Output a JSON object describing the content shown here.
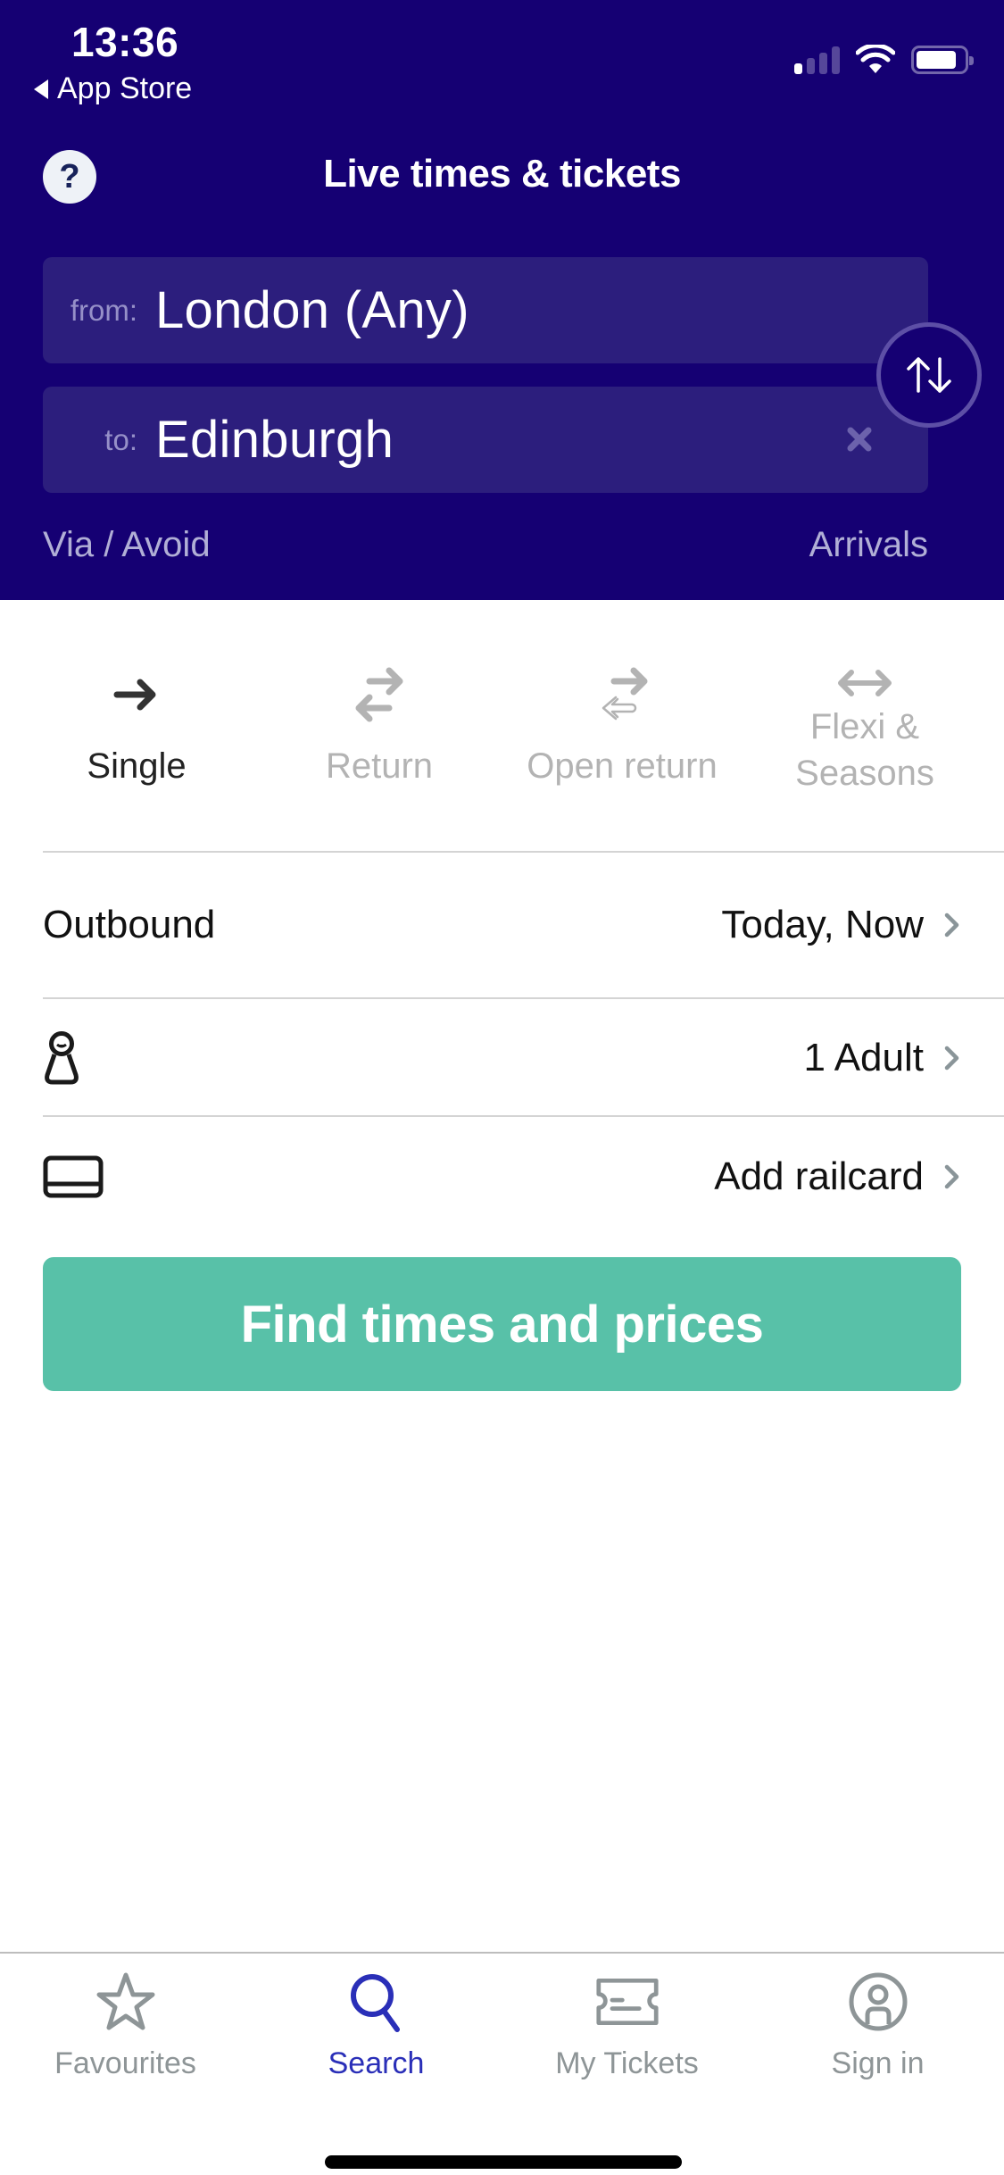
{
  "status_bar": {
    "time": "13:36",
    "back_label": "App Store",
    "signal_bars_on": 1,
    "signal_bars_total": 4,
    "battery_level": 0.85
  },
  "header": {
    "title": "Live times & tickets",
    "help_icon": "?",
    "from_label": "from:",
    "from_value": "London (Any)",
    "to_label": "to:",
    "to_value": "Edinburgh",
    "via_avoid": "Via / Avoid",
    "arrivals": "Arrivals"
  },
  "journey_types": [
    {
      "label": "Single",
      "icon": "arrow-right-icon",
      "active": true
    },
    {
      "label": "Return",
      "icon": "return-arrows-icon",
      "active": false
    },
    {
      "label": "Open return",
      "icon": "open-return-arrows-icon",
      "active": false
    },
    {
      "label": "Flexi & Seasons",
      "label_line1": "Flexi &",
      "label_line2": "Seasons",
      "icon": "double-arrow-icon",
      "active": false
    }
  ],
  "rows": {
    "outbound_label": "Outbound",
    "outbound_value": "Today, Now",
    "passengers_value": "1 Adult",
    "railcard_value": "Add railcard"
  },
  "cta_label": "Find times and prices",
  "tabs": [
    {
      "label": "Favourites",
      "icon": "star-icon",
      "active": false
    },
    {
      "label": "Search",
      "icon": "search-icon",
      "active": true
    },
    {
      "label": "My Tickets",
      "icon": "ticket-icon",
      "active": false
    },
    {
      "label": "Sign in",
      "icon": "account-icon",
      "active": false
    }
  ],
  "colors": {
    "header_bg": "#150073",
    "field_bg": "#2c1e7d",
    "cta": "#58c1a8",
    "active_tab": "#2a2fb8",
    "inactive": "#8e9597"
  }
}
